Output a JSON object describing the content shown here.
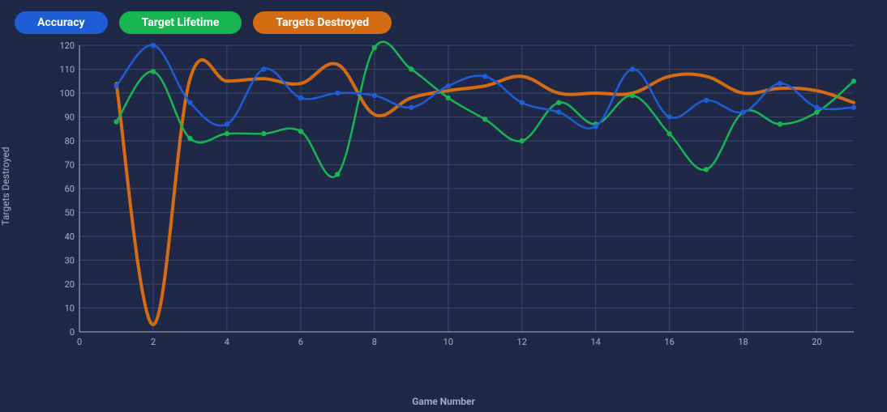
{
  "legend": [
    {
      "label": "Accuracy",
      "color": "#1e5dd6"
    },
    {
      "label": "Target Lifetime",
      "color": "#1ab553"
    },
    {
      "label": "Targets Destroyed",
      "color": "#d36c12"
    }
  ],
  "chart_data": {
    "type": "line",
    "title": "",
    "xlabel": "Game Number",
    "ylabel": "Targets Destroyed",
    "xlim": [
      0,
      21
    ],
    "ylim": [
      0,
      120
    ],
    "x_ticks": [
      0,
      2,
      4,
      6,
      8,
      10,
      12,
      14,
      16,
      18,
      20
    ],
    "y_ticks": [
      0,
      10,
      20,
      30,
      40,
      50,
      60,
      70,
      80,
      90,
      100,
      110,
      120
    ],
    "x": [
      1,
      2,
      3,
      4,
      5,
      6,
      7,
      8,
      9,
      10,
      11,
      12,
      13,
      14,
      15,
      16,
      17,
      18,
      19,
      20,
      21
    ],
    "series": [
      {
        "name": "Targets Destroyed",
        "color": "#d36c12",
        "stroke_width": 4,
        "markers": false,
        "values": [
          104,
          3,
          106,
          105,
          106,
          104,
          112,
          91,
          98,
          101,
          103,
          107,
          100,
          100,
          100,
          107,
          107,
          100,
          102,
          101,
          96
        ]
      },
      {
        "name": "Target Lifetime",
        "color": "#1ab553",
        "stroke_width": 2.5,
        "markers": true,
        "values": [
          88,
          109,
          81,
          83,
          83,
          84,
          66,
          119,
          110,
          98,
          89,
          80,
          96,
          87,
          99,
          83,
          68,
          92,
          87,
          92,
          105
        ]
      },
      {
        "name": "Accuracy",
        "color": "#1e5dd6",
        "stroke_width": 2.5,
        "markers": true,
        "values": [
          103,
          120,
          96,
          87,
          110,
          98,
          100,
          99,
          94,
          103,
          107,
          96,
          92,
          86,
          110,
          90,
          97,
          92,
          104,
          94,
          94
        ]
      }
    ]
  }
}
